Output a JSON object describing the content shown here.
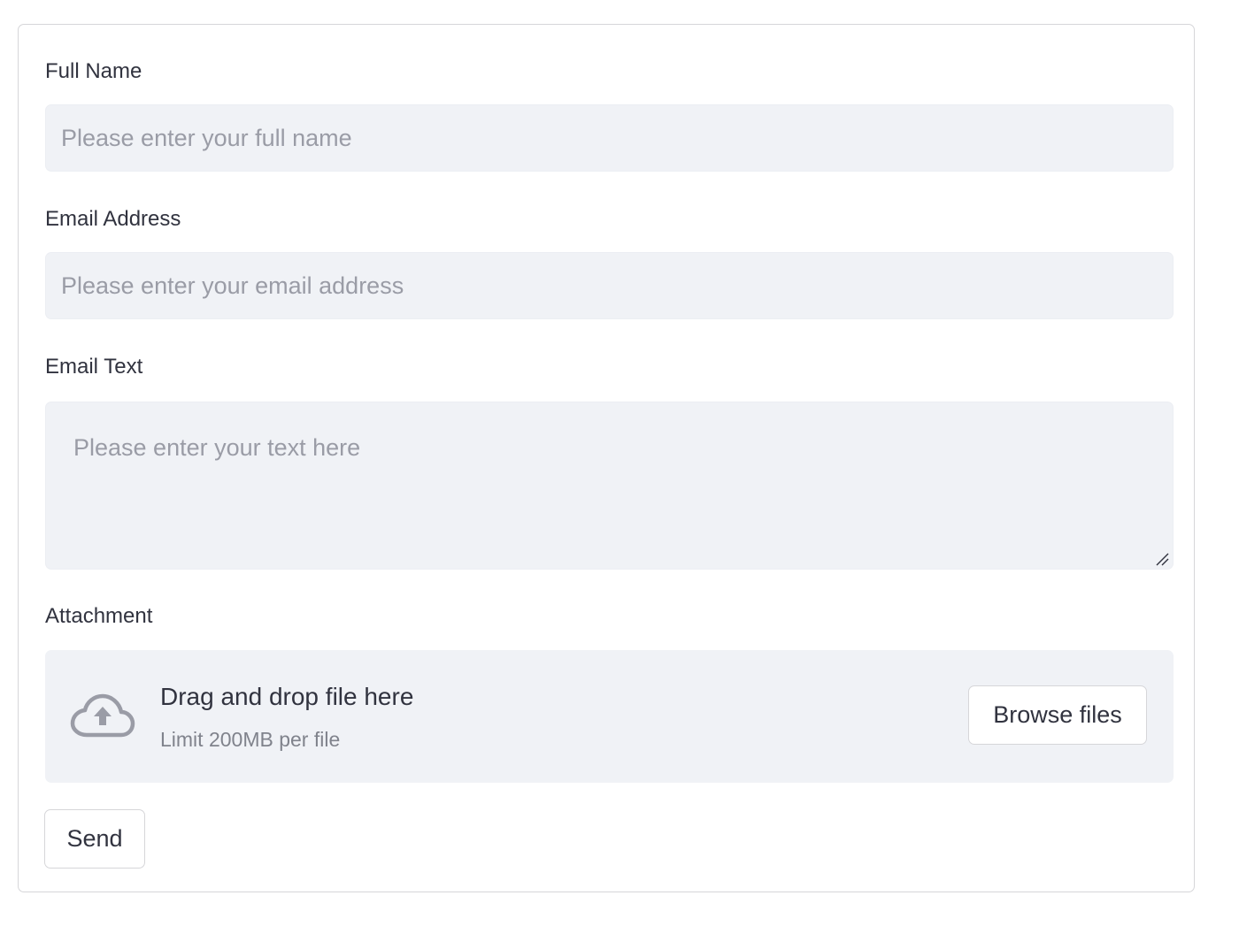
{
  "form": {
    "full_name": {
      "label": "Full Name",
      "value": "",
      "placeholder": "Please enter your full name"
    },
    "email": {
      "label": "Email Address",
      "value": "",
      "placeholder": "Please enter your email address"
    },
    "email_text": {
      "label": "Email Text",
      "value": "",
      "placeholder": "Please enter your text here"
    },
    "attachment": {
      "label": "Attachment",
      "drop_title": "Drag and drop file here",
      "limit_text": "Limit 200MB per file",
      "browse_label": "Browse files",
      "icon": "cloud-upload-icon"
    },
    "send_label": "Send"
  },
  "colors": {
    "input_bg": "#f0f2f6",
    "text": "#31333f",
    "placeholder": "#9a9ca6",
    "border": "#d6d6d9"
  }
}
